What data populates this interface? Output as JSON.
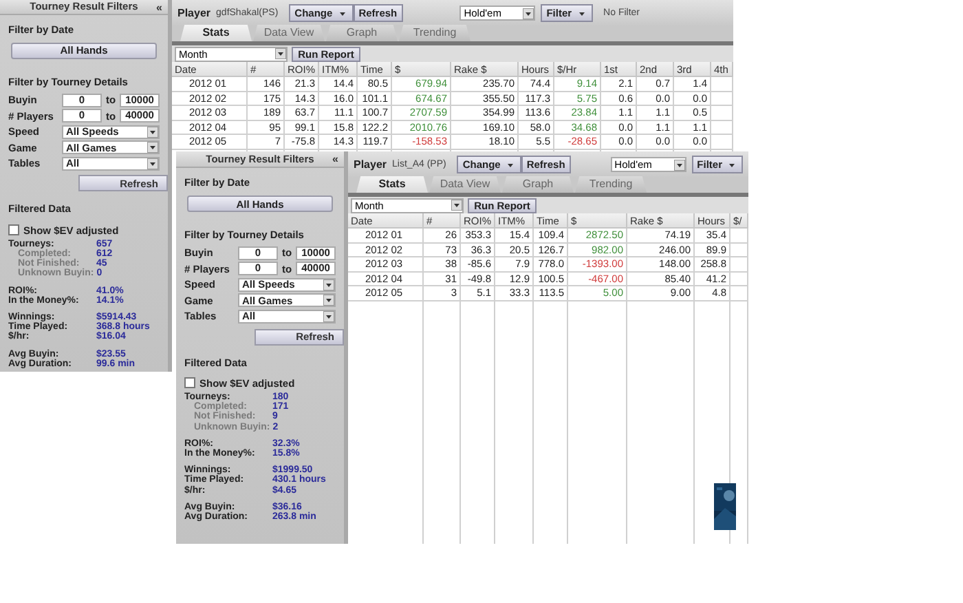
{
  "windows": [
    {
      "filters": {
        "title": "Tourney Result Filters",
        "collapse": "«",
        "date_heading": "Filter by Date",
        "date_button": "All Hands",
        "details_heading": "Filter by Tourney Details",
        "ranges": [
          {
            "label": "Buyin",
            "from": "0",
            "to_word": "to",
            "to": "10000"
          },
          {
            "label": "# Players",
            "from": "0",
            "to_word": "to",
            "to": "40000"
          }
        ],
        "selects": [
          {
            "label": "Speed",
            "value": "All Speeds"
          },
          {
            "label": "Game",
            "value": "All Games"
          },
          {
            "label": "Tables",
            "value": "All"
          }
        ],
        "refresh": "Refresh",
        "data_heading": "Filtered Data",
        "ev_checkbox": {
          "label": "Show $EV adjusted",
          "checked": false
        },
        "stat_groups": [
          [
            {
              "kind": "main",
              "label": "Tourneys:",
              "value": "657"
            },
            {
              "kind": "sub",
              "label": "Completed:",
              "value": "612"
            },
            {
              "kind": "sub",
              "label": "Not Finished:",
              "value": "45"
            },
            {
              "kind": "sub",
              "label": "Unknown Buyin:",
              "value": "0"
            }
          ],
          [
            {
              "kind": "main",
              "label": "ROI%:",
              "value": "41.0%"
            },
            {
              "kind": "main",
              "label": "In the Money%:",
              "value": "14.1%"
            }
          ],
          [
            {
              "kind": "main",
              "label": "Winnings:",
              "value": "$5914.43"
            },
            {
              "kind": "main",
              "label": "Time Played:",
              "value": "368.8 hours"
            },
            {
              "kind": "main",
              "label": "$/hr:",
              "value": "$16.04"
            }
          ],
          [
            {
              "kind": "main",
              "label": "Avg Buyin:",
              "value": "$23.55"
            },
            {
              "kind": "main",
              "label": "Avg Duration:",
              "value": "99.6 min"
            }
          ]
        ]
      },
      "toolbar": {
        "player_label": "Player",
        "player": "gdfShakal(PS)",
        "change": "Change",
        "refresh": "Refresh",
        "game": "Hold'em",
        "filter": "Filter",
        "filter_status": "No Filter"
      },
      "tabs": [
        {
          "label": "Stats",
          "selected": true
        },
        {
          "label": "Data View",
          "selected": false
        },
        {
          "label": "Graph",
          "selected": false
        },
        {
          "label": "Trending",
          "selected": false
        }
      ],
      "period": "Month",
      "run_report": "Run Report",
      "columns": [
        "Date",
        "#",
        "ROI%",
        "ITM%",
        "Time",
        "$",
        "Rake $",
        "Hours",
        "$/Hr",
        "1st",
        "2nd",
        "3rd",
        "4th"
      ],
      "rows": [
        {
          "cells": [
            "2012 01",
            "146",
            "21.3",
            "14.4",
            "80.5",
            {
              "text": "679.94",
              "color": "#3f8f3a"
            },
            "235.70",
            "74.4",
            {
              "text": "9.14",
              "color": "#3f8f3a"
            },
            "2.1",
            "0.7",
            "1.4"
          ]
        },
        {
          "cells": [
            "2012 02",
            "175",
            "14.3",
            "16.0",
            "101.1",
            {
              "text": "674.67",
              "color": "#3f8f3a"
            },
            "355.50",
            "117.3",
            {
              "text": "5.75",
              "color": "#3f8f3a"
            },
            "0.6",
            "0.0",
            "0.0"
          ]
        },
        {
          "cells": [
            "2012 03",
            "189",
            "63.7",
            "11.1",
            "100.7",
            {
              "text": "2707.59",
              "color": "#3f8f3a"
            },
            "354.99",
            "113.6",
            {
              "text": "23.84",
              "color": "#3f8f3a"
            },
            "1.1",
            "1.1",
            "0.5"
          ]
        },
        {
          "cells": [
            "2012 04",
            "95",
            "99.1",
            "15.8",
            "122.2",
            {
              "text": "2010.76",
              "color": "#3f8f3a"
            },
            "169.10",
            "58.0",
            {
              "text": "34.68",
              "color": "#3f8f3a"
            },
            "0.0",
            "1.1",
            "1.1"
          ]
        },
        {
          "cells": [
            "2012 05",
            "7",
            "-75.8",
            "14.3",
            "119.7",
            {
              "text": "-158.53",
              "color": "#d03a3a"
            },
            "18.10",
            "5.5",
            {
              "text": "-28.65",
              "color": "#d03a3a"
            },
            "0.0",
            "0.0",
            "0.0"
          ]
        }
      ]
    },
    {
      "filters": {
        "title": "Tourney Result Filters",
        "collapse": "«",
        "date_heading": "Filter by Date",
        "date_button": "All Hands",
        "details_heading": "Filter by Tourney Details",
        "ranges": [
          {
            "label": "Buyin",
            "from": "0",
            "to_word": "to",
            "to": "10000"
          },
          {
            "label": "# Players",
            "from": "0",
            "to_word": "to",
            "to": "40000"
          }
        ],
        "selects": [
          {
            "label": "Speed",
            "value": "All Speeds"
          },
          {
            "label": "Game",
            "value": "All Games"
          },
          {
            "label": "Tables",
            "value": "All"
          }
        ],
        "refresh": "Refresh",
        "data_heading": "Filtered Data",
        "ev_checkbox": {
          "label": "Show $EV adjusted",
          "checked": false
        },
        "stat_groups": [
          [
            {
              "kind": "main",
              "label": "Tourneys:",
              "value": "180"
            },
            {
              "kind": "sub",
              "label": "Completed:",
              "value": "171"
            },
            {
              "kind": "sub",
              "label": "Not Finished:",
              "value": "9"
            },
            {
              "kind": "sub",
              "label": "Unknown Buyin:",
              "value": "2"
            }
          ],
          [
            {
              "kind": "main",
              "label": "ROI%:",
              "value": "32.3%"
            },
            {
              "kind": "main",
              "label": "In the Money%:",
              "value": "15.8%"
            }
          ],
          [
            {
              "kind": "main",
              "label": "Winnings:",
              "value": "$1999.50"
            },
            {
              "kind": "main",
              "label": "Time Played:",
              "value": "430.1 hours"
            },
            {
              "kind": "main",
              "label": "$/hr:",
              "value": "$4.65"
            }
          ],
          [
            {
              "kind": "main",
              "label": "Avg Buyin:",
              "value": "$36.16"
            },
            {
              "kind": "main",
              "label": "Avg Duration:",
              "value": "263.8 min"
            }
          ]
        ]
      },
      "toolbar": {
        "player_label": "Player",
        "player": "List_A4 (PP)",
        "change": "Change",
        "refresh": "Refresh",
        "game": "Hold'em",
        "filter": "Filter"
      },
      "tabs": [
        {
          "label": "Stats",
          "selected": true
        },
        {
          "label": "Data View",
          "selected": false
        },
        {
          "label": "Graph",
          "selected": false
        },
        {
          "label": "Trending",
          "selected": false
        }
      ],
      "period": "Month",
      "run_report": "Run Report",
      "columns": [
        "Date",
        "#",
        "ROI%",
        "ITM%",
        "Time",
        "$",
        "Rake $",
        "Hours",
        "$/"
      ],
      "rows": [
        {
          "cells": [
            "2012 01",
            "26",
            "353.3",
            "15.4",
            "109.4",
            {
              "text": "2872.50",
              "color": "#3f8f3a"
            },
            "74.19",
            "35.4"
          ]
        },
        {
          "cells": [
            "2012 02",
            "73",
            "36.3",
            "20.5",
            "126.7",
            {
              "text": "982.00",
              "color": "#3f8f3a"
            },
            "246.00",
            "89.9"
          ]
        },
        {
          "cells": [
            "2012 03",
            "38",
            "-85.6",
            "7.9",
            "778.0",
            {
              "text": "-1393.00",
              "color": "#d03a3a"
            },
            "148.00",
            "258.8"
          ]
        },
        {
          "cells": [
            "2012 04",
            "31",
            "-49.8",
            "12.9",
            "100.5",
            {
              "text": "-467.00",
              "color": "#d03a3a"
            },
            "85.40",
            "41.2"
          ]
        },
        {
          "cells": [
            "2012 05",
            "3",
            "5.1",
            "33.3",
            "113.5",
            {
              "text": "5.00",
              "color": "#3f8f3a"
            },
            "9.00",
            "4.8"
          ]
        }
      ]
    }
  ]
}
